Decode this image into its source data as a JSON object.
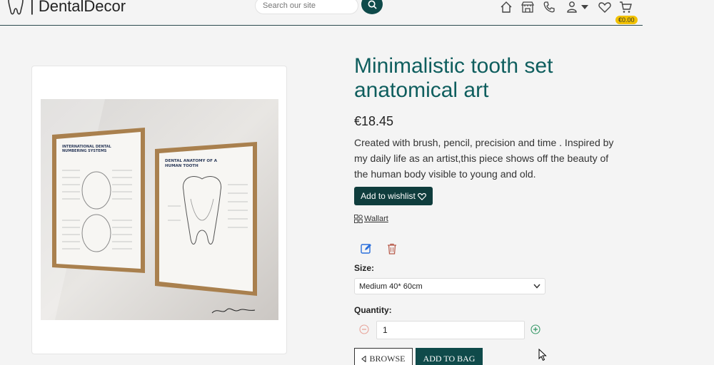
{
  "header": {
    "brand_name": "| DentalDecor",
    "search_placeholder": "Search our site",
    "cart_total": "€0.00"
  },
  "product": {
    "title": "Minimalistic tooth set anatomical art",
    "price": "€18.45",
    "description": "Created with brush, pencil, precision and time . Inspired by my daily life as an artist,this piece shows off the beauty of the human body visible to young and old.",
    "wishlist_label": "Add to wishlist",
    "category": "Wallart",
    "size_label": "Size:",
    "size_selected": "Medium 40* 60cm",
    "quantity_label": "Quantity:",
    "quantity_value": "1",
    "browse_label": "BROWSE",
    "add_to_bag_label": "ADD TO BAG"
  },
  "poster_left": {
    "title": "INTERNATIONAL DENTAL NUMBERING SYSTEMS"
  },
  "poster_right": {
    "title": "DENTAL ANATOMY OF A HUMAN TOOTH"
  },
  "colors": {
    "brand_teal": "#0f5e5e",
    "button_dark": "#0f3d3d",
    "badge_yellow": "#f2c200",
    "edit_blue": "#2a6fdb",
    "delete_red": "#b85c4c"
  },
  "icons": [
    "tooth-logo-icon",
    "search-icon",
    "home-icon",
    "store-icon",
    "phone-icon",
    "user-icon",
    "chevron-down-icon",
    "heart-icon",
    "cart-icon",
    "category-icon",
    "edit-icon",
    "trash-icon",
    "minus-circle-icon",
    "plus-circle-icon",
    "chevron-left-icon"
  ]
}
